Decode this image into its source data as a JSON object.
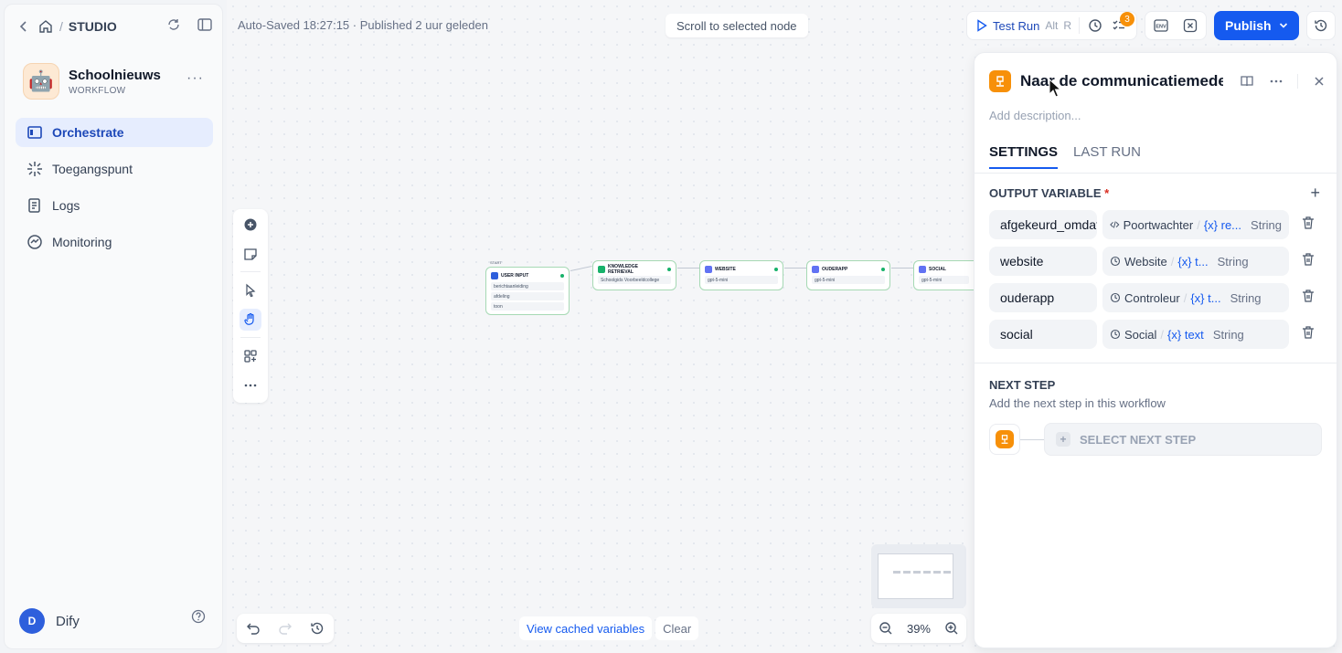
{
  "breadcrumb": {
    "section": "STUDIO",
    "separator": "/"
  },
  "app": {
    "name": "Schoolnieuws",
    "type": "WORKFLOW",
    "avatar": "🤖"
  },
  "nav": [
    {
      "label": "Orchestrate",
      "icon": "orchestrate-icon",
      "active": true
    },
    {
      "label": "Toegangspunt",
      "icon": "access-point-icon",
      "active": false
    },
    {
      "label": "Logs",
      "icon": "logs-icon",
      "active": false
    },
    {
      "label": "Monitoring",
      "icon": "monitoring-icon",
      "active": false
    }
  ],
  "user": {
    "initial": "D",
    "name": "Dify"
  },
  "status_text": "Auto-Saved 18:27:15 · Published 2 uur geleden",
  "scroll_to_node": "Scroll to selected node",
  "toolbar": {
    "test_run": "Test Run",
    "shortcut_alt": "Alt",
    "shortcut_r": "R",
    "checklist_count": "3",
    "env_label": "ENV",
    "publish": "Publish"
  },
  "nodes": {
    "start_label": "START",
    "user_input": {
      "title": "USER INPUT",
      "vars": [
        {
          "name": "berichtaanleiding",
          "type": ""
        },
        {
          "name": "afdeling",
          "type": ""
        },
        {
          "name": "toon",
          "type": ""
        }
      ]
    },
    "knowledge": {
      "title": "KNOWLEDGE RETRIEVAL",
      "dataset": "Schoolgids Voorbeeldcollege"
    },
    "website": {
      "title": "WEBSITE",
      "model": "gpt-5-mini"
    },
    "ouderapp": {
      "title": "OUDERAPP",
      "model": "gpt-5-mini"
    },
    "social": {
      "title": "SOCIAL",
      "model": "gpt-5-mini"
    }
  },
  "bottom": {
    "view_cached": "View cached variables",
    "clear": "Clear",
    "zoom": "39%"
  },
  "panel": {
    "title": "Naar de communicatiemedewerker",
    "description_placeholder": "Add description...",
    "tabs": [
      "SETTINGS",
      "LAST RUN"
    ],
    "output_heading": "OUTPUT VARIABLE",
    "outputs": [
      {
        "name": "afgekeurd_omdat",
        "source": "Poortwachter",
        "var": "re...",
        "type": "String",
        "source_icon": "code-icon"
      },
      {
        "name": "website",
        "source": "Website",
        "var": "t...",
        "type": "String",
        "source_icon": "llm-icon"
      },
      {
        "name": "ouderapp",
        "source": "Controleur",
        "var": "t...",
        "type": "String",
        "source_icon": "llm-icon"
      },
      {
        "name": "social",
        "source": "Social",
        "var": "text",
        "type": "String",
        "source_icon": "llm-icon"
      }
    ],
    "next_step_heading": "NEXT STEP",
    "next_step_sub": "Add the next step in this workflow",
    "select_next_step": "SELECT NEXT STEP"
  },
  "colors": {
    "accent": "#155aef",
    "end_node": "#f79009",
    "success": "#17b26a"
  }
}
